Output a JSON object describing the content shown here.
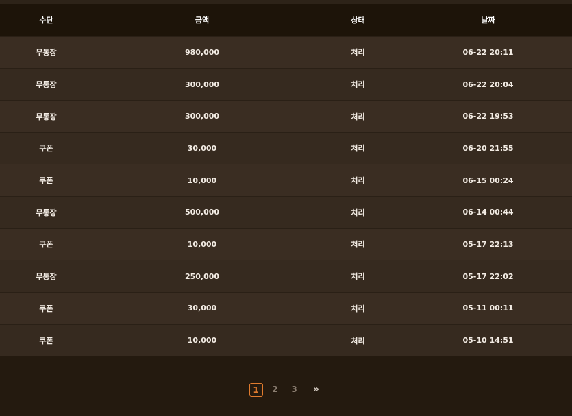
{
  "table": {
    "headers": [
      "수단",
      "금액",
      "상태",
      "날짜"
    ],
    "rows": [
      {
        "method": "무통장",
        "amount": "980,000",
        "status": "처리",
        "date": "06-22 20:11"
      },
      {
        "method": "무통장",
        "amount": "300,000",
        "status": "처리",
        "date": "06-22 20:04"
      },
      {
        "method": "무통장",
        "amount": "300,000",
        "status": "처리",
        "date": "06-22 19:53"
      },
      {
        "method": "쿠폰",
        "amount": "30,000",
        "status": "처리",
        "date": "06-20 21:55"
      },
      {
        "method": "쿠폰",
        "amount": "10,000",
        "status": "처리",
        "date": "06-15 00:24"
      },
      {
        "method": "무통장",
        "amount": "500,000",
        "status": "처리",
        "date": "06-14 00:44"
      },
      {
        "method": "쿠폰",
        "amount": "10,000",
        "status": "처리",
        "date": "05-17 22:13"
      },
      {
        "method": "무통장",
        "amount": "250,000",
        "status": "처리",
        "date": "05-17 22:02"
      },
      {
        "method": "쿠폰",
        "amount": "30,000",
        "status": "처리",
        "date": "05-11 00:11"
      },
      {
        "method": "쿠폰",
        "amount": "10,000",
        "status": "처리",
        "date": "05-10 14:51"
      }
    ]
  },
  "pagination": {
    "pages": [
      "1",
      "2",
      "3"
    ],
    "active": "1",
    "next_label": "»",
    "next_icon": "double-chevron-right-icon"
  },
  "colors": {
    "accent": "#e07b2e",
    "header_bg": "#1d1409",
    "row_bg": "#3a2d22",
    "page_bg": "#241a0f"
  }
}
